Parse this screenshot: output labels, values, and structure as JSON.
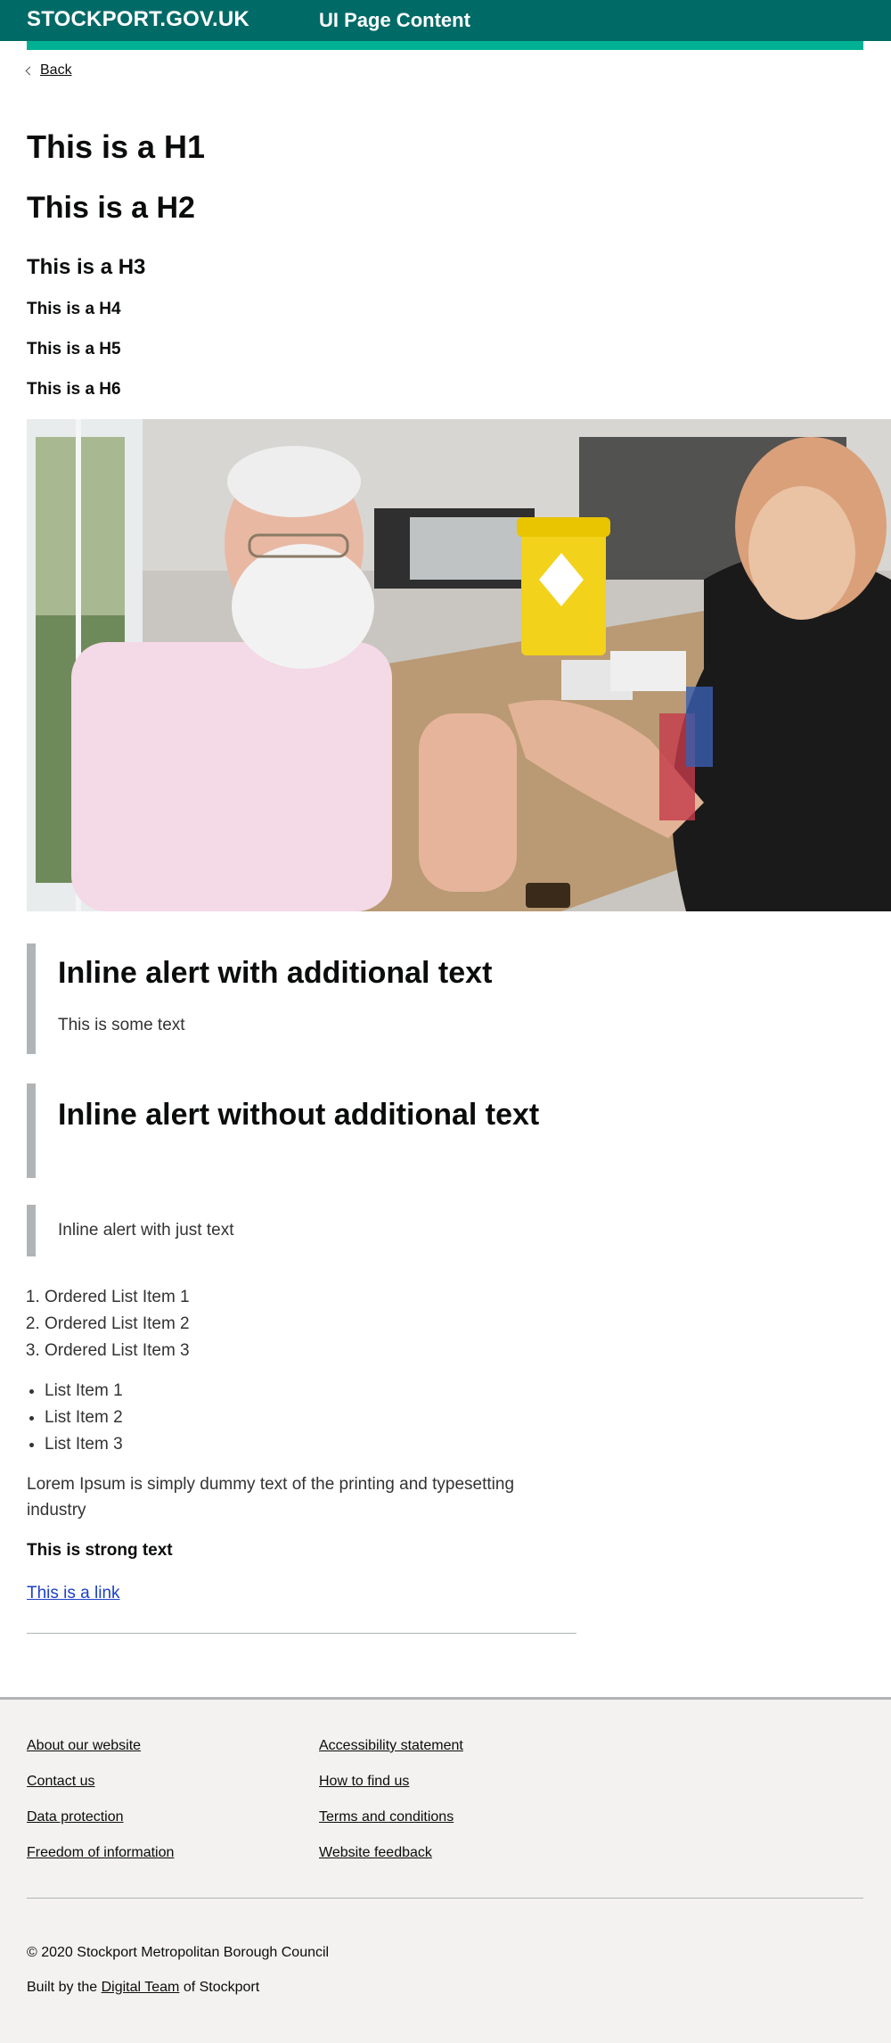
{
  "header": {
    "brand": "STOCKPORT.GOV.UK",
    "service": "UI Page Content",
    "brand_color": "#006a67",
    "accent_color": "#00b093"
  },
  "nav": {
    "back_label": "Back"
  },
  "headings": {
    "h1": "This is a H1",
    "h2": "This is a H2",
    "h3": "This is a H3",
    "h4": "This is a H4",
    "h5": "This is a H5",
    "h6": "This is a H6"
  },
  "alerts": [
    {
      "title": "Inline alert with additional text",
      "text": "This is some text"
    },
    {
      "title": "Inline alert without additional text"
    },
    {
      "text": "Inline alert with just text"
    }
  ],
  "ordered_list": [
    "Ordered List Item 1",
    "Ordered List Item 2",
    "Ordered List Item 3"
  ],
  "unordered_list": [
    "List Item 1",
    "List Item 2",
    "List Item 3"
  ],
  "body": {
    "lorem": "Lorem Ipsum is simply dummy text of the printing and typesetting industry",
    "strong": "This is strong text",
    "link": "This is a link",
    "link_color": "#1d40c6"
  },
  "footer": {
    "col1": [
      "About our website",
      "Contact us",
      "Data protection",
      "Freedom of information"
    ],
    "col2": [
      "Accessibility statement",
      "How to find us",
      "Terms and conditions",
      "Website feedback"
    ],
    "copyright": "© 2020 Stockport Metropolitan Borough Council",
    "built_prefix": "Built by the",
    "built_link": "Digital Team",
    "built_suffix": "of Stockport"
  }
}
